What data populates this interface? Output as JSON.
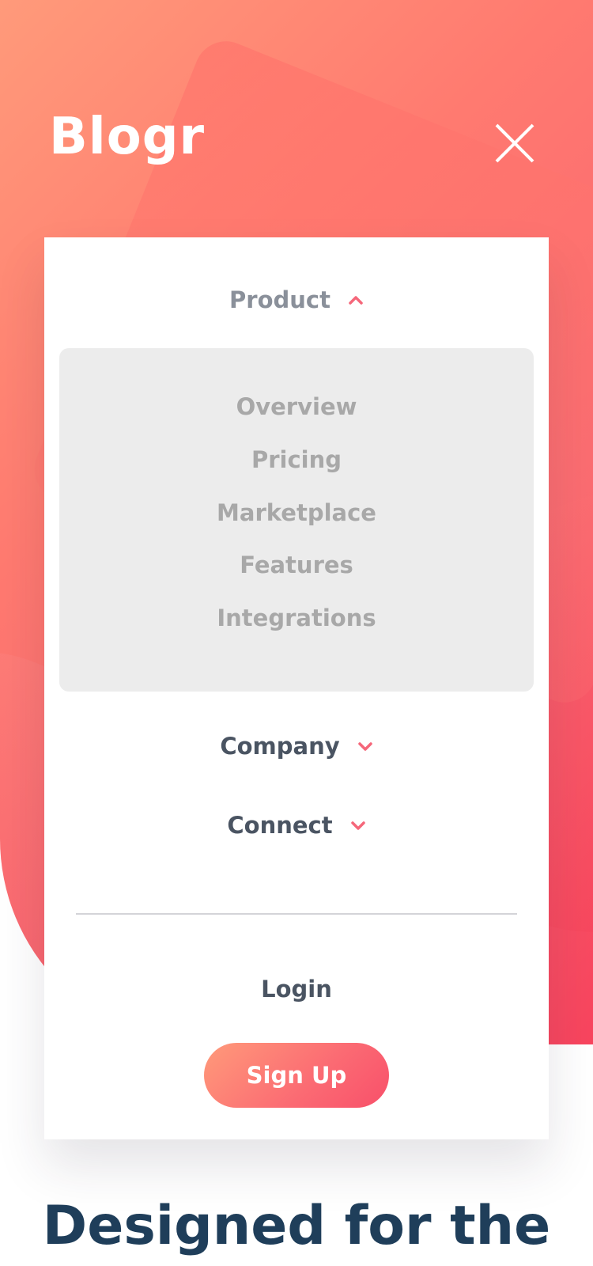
{
  "brand": {
    "logo_text": "Blogr",
    "colors": {
      "gradient_start": "#ff9a7a",
      "gradient_end": "#f8445e",
      "accent": "#fb6a73",
      "nav_text": "#4a5462",
      "headline": "#1f3e5a"
    }
  },
  "header": {
    "close_icon": "close-icon"
  },
  "menu": {
    "product": {
      "label": "Product",
      "icon": "chevron-up-icon",
      "expanded": true,
      "items": [
        "Overview",
        "Pricing",
        "Marketplace",
        "Features",
        "Integrations"
      ]
    },
    "company": {
      "label": "Company",
      "icon": "chevron-down-icon",
      "expanded": false
    },
    "connect": {
      "label": "Connect",
      "icon": "chevron-down-icon",
      "expanded": false
    },
    "login_label": "Login",
    "signup_label": "Sign Up"
  },
  "hero": {
    "headline": "Designed for the"
  }
}
